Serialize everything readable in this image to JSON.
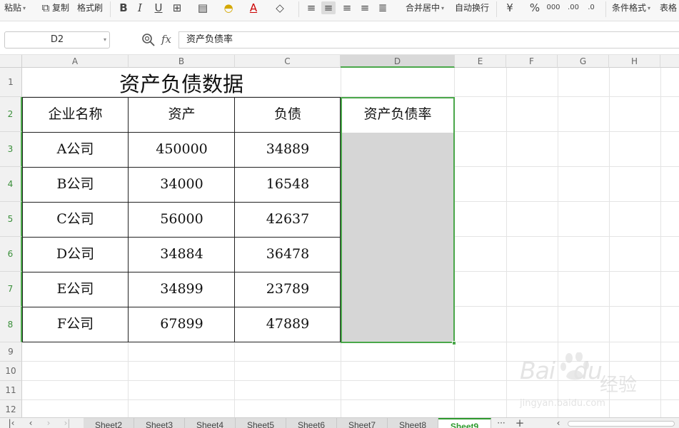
{
  "toolbar": {
    "paste": "粘贴",
    "copy": "复制",
    "format_painter": "格式刷",
    "merge_center": "合并居中",
    "wrap_text": "自动换行",
    "conditional_format": "条件格式",
    "table_style": "表格"
  },
  "formula_bar": {
    "name_box": "D2",
    "fx": "fx",
    "formula": "资产负债率"
  },
  "columns": [
    "A",
    "B",
    "C",
    "D",
    "E",
    "F",
    "G",
    "H"
  ],
  "rows": [
    "1",
    "2",
    "3",
    "4",
    "5",
    "6",
    "7",
    "8",
    "9",
    "10",
    "11",
    "12"
  ],
  "sheet": {
    "title": "资产负债数据",
    "headers": [
      "企业名称",
      "资产",
      "负债",
      "资产负债率"
    ],
    "data": [
      [
        "A公司",
        "450000",
        "34889",
        ""
      ],
      [
        "B公司",
        "34000",
        "16548",
        ""
      ],
      [
        "C公司",
        "56000",
        "42637",
        ""
      ],
      [
        "D公司",
        "34884",
        "36478",
        ""
      ],
      [
        "E公司",
        "34899",
        "23789",
        ""
      ],
      [
        "F公司",
        "67899",
        "47889",
        ""
      ]
    ]
  },
  "tabs": [
    "Sheet2",
    "Sheet3",
    "Sheet4",
    "Sheet5",
    "Sheet6",
    "Sheet7",
    "Sheet8",
    "Sheet9"
  ],
  "active_tab": "Sheet9",
  "tab_controls": {
    "more": "···",
    "add": "+"
  },
  "watermark": {
    "brand": "Bai",
    "brand2": "du",
    "cn": "经验",
    "url": "jingyan.baidu.com"
  },
  "colors": {
    "accent": "#4aa74a",
    "selection_fill": "#d6d6d6",
    "active_tab": "#2e9a2e"
  }
}
